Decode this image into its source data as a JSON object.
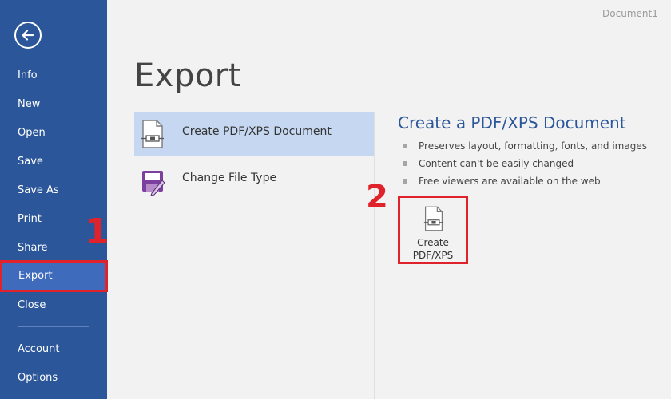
{
  "window": {
    "doc_title": "Document1 -"
  },
  "sidebar": {
    "items": [
      {
        "label": "Info"
      },
      {
        "label": "New"
      },
      {
        "label": "Open"
      },
      {
        "label": "Save"
      },
      {
        "label": "Save As"
      },
      {
        "label": "Print"
      },
      {
        "label": "Share"
      },
      {
        "label": "Export"
      },
      {
        "label": "Close"
      },
      {
        "label": "Account"
      },
      {
        "label": "Options"
      }
    ]
  },
  "annotations": {
    "step1": "1",
    "step2": "2",
    "color": "#e0232b"
  },
  "main": {
    "title": "Export",
    "options": [
      {
        "label": "Create PDF/XPS Document",
        "icon": "pdf-document-icon"
      },
      {
        "label": "Change File Type",
        "icon": "change-file-type-icon"
      }
    ],
    "detail": {
      "title": "Create a PDF/XPS Document",
      "bullets": [
        "Preserves layout, formatting, fonts, and images",
        "Content can't be easily changed",
        "Free viewers are available on the web"
      ],
      "button": {
        "line1": "Create",
        "line2": "PDF/XPS"
      }
    }
  },
  "colors": {
    "sidebar": "#2b579a",
    "selected": "#c6d8f1",
    "accent": "#2b579a"
  }
}
